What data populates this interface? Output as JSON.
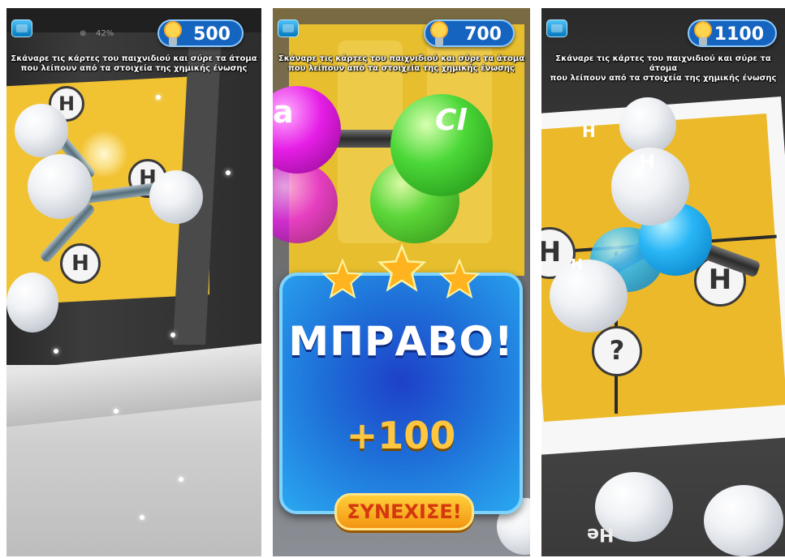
{
  "instruction_lines": [
    "Σκάναρε τις κάρτες του παιχνιδιού και σύρε τα άτομα",
    "που λείπουν από τα στοιχεία της χημικής ένωσης"
  ],
  "screens": [
    {
      "score": "500",
      "toolbar": {
        "zoom": "42%"
      },
      "card_labels": [
        "H",
        "H",
        "H"
      ]
    },
    {
      "score": "700",
      "atom_labels": [
        "a",
        "Cl"
      ],
      "result": {
        "title": "ΜΠΡΑΒΟ!",
        "bonus": "+100",
        "stars": 3,
        "continue_label": "ΣΥΝΕΧΙΣΕ!"
      }
    },
    {
      "score": "1100",
      "card_labels": [
        "H",
        "H",
        "?"
      ],
      "atom_labels": [
        "H",
        "H",
        "H"
      ],
      "bottom_text": "He"
    }
  ],
  "colors": {
    "score_badge": "#1565c0",
    "card_yellow": "#f3c623",
    "result_card": "#1e6fd8",
    "bonus": "#ffc640",
    "continue_button": "#f7b22a"
  }
}
